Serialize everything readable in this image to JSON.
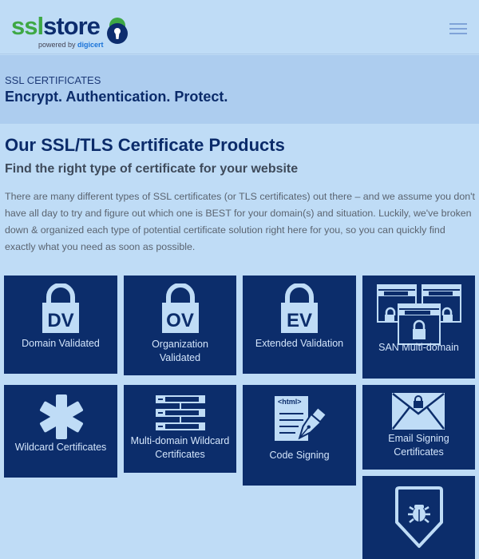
{
  "header": {
    "logo": {
      "part1": "ssl",
      "part2": "store",
      "powered_by": "powered by",
      "brand": "digicert"
    },
    "menu_icon": "hamburger-menu-icon"
  },
  "banner": {
    "kicker": "SSL CERTIFICATES",
    "title": "Encrypt. Authentication. Protect."
  },
  "main": {
    "title": "Our SSL/TLS Certificate Products",
    "subtitle": "Find the right type of certificate for your website",
    "intro": "There are many different types of SSL certificates (or TLS certificates) out there – and we assume you don't have all day to try and figure out which one is BEST for your domain(s) and situation. Luckily, we've broken down & organized each type of potential certificate solution right here for you, so you can quickly find exactly what you need as soon as possible."
  },
  "products": [
    {
      "label": "Domain Validated",
      "badge": "DV",
      "icon": "padlock-dv-icon"
    },
    {
      "label": "Organization Validated",
      "line1": "Organization",
      "line2": "Validated",
      "badge": "OV",
      "icon": "padlock-ov-icon"
    },
    {
      "label": "Extended Validation",
      "badge": "EV",
      "icon": "padlock-ev-icon"
    },
    {
      "label": "SAN Multi-domain",
      "icon": "multi-browser-window-icon"
    },
    {
      "label": "Wildcard Certificates",
      "icon": "asterisk-icon"
    },
    {
      "label": "Multi-domain Wildcard Certificates",
      "line1": "Multi-domain Wildcard",
      "line2": "Certificates",
      "icon": "domain-list-icon"
    },
    {
      "label": "Code Signing",
      "icon": "html-document-pen-icon",
      "doc_text": "<html>"
    },
    {
      "label": "Email Signing Certificates",
      "line1": "Email Signing",
      "line2": "Certificates",
      "icon": "envelope-lock-icon"
    },
    {
      "label": "",
      "icon": "shield-bug-icon"
    }
  ],
  "colors": {
    "tile_bg": "#0c2d6b",
    "icon": "#bfdcf6",
    "page_bg": "#bfdcf6",
    "banner_bg": "#adcdef",
    "brand_green": "#3ea845",
    "brand_navy": "#0d2d6e"
  }
}
